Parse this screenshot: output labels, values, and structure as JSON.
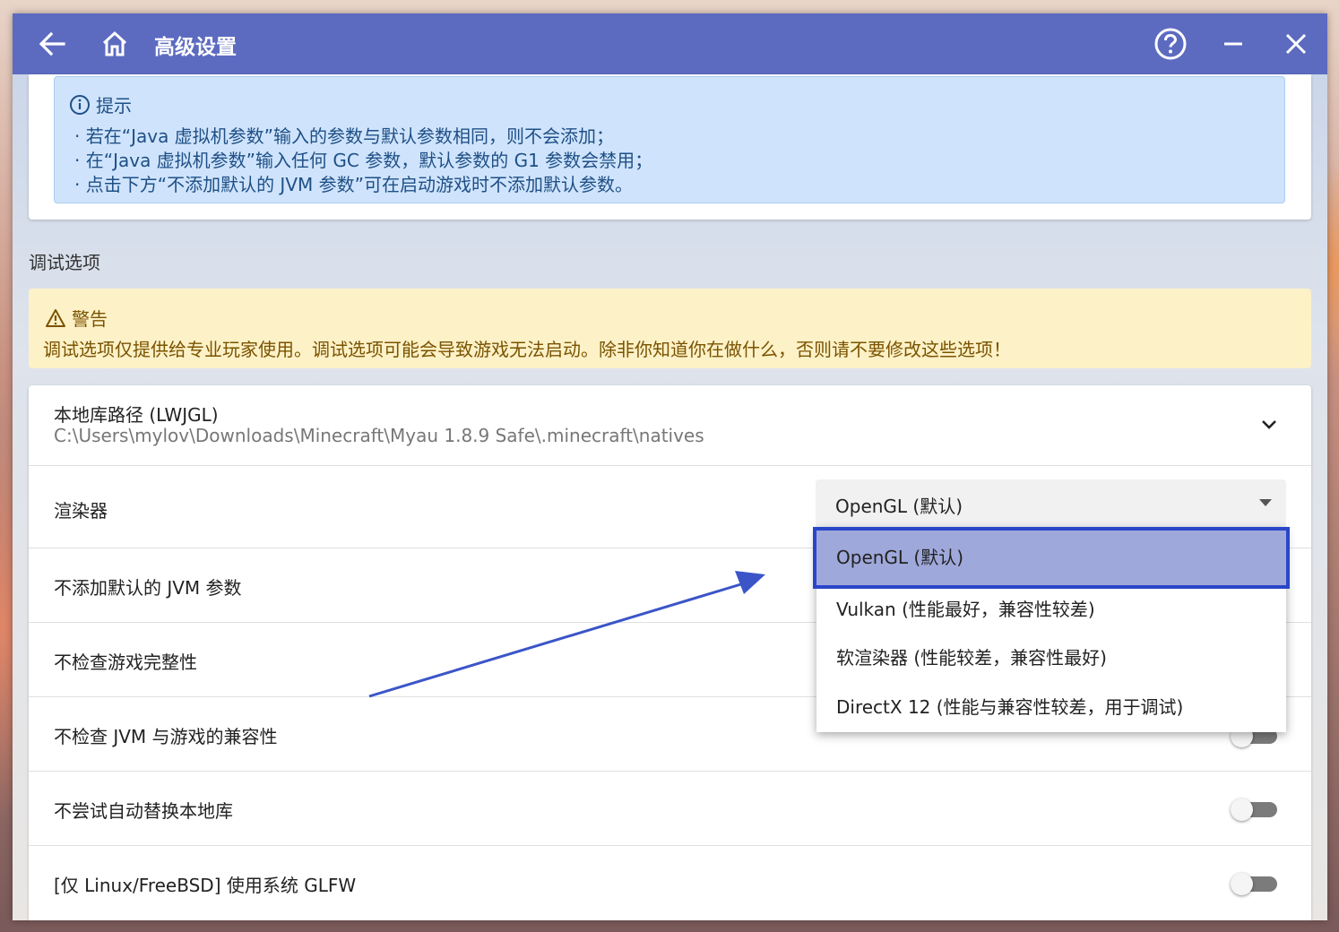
{
  "titlebar": {
    "title": "高级设置",
    "back_icon": "arrow-left-icon",
    "home_icon": "home-icon",
    "help_icon": "help-circle-icon",
    "minimize_icon": "minimize-icon",
    "close_icon": "close-icon"
  },
  "tip": {
    "title": "提示",
    "lines": [
      "· 若在“Java 虚拟机参数”输入的参数与默认参数相同，则不会添加；",
      "· 在“Java 虚拟机参数”输入任何 GC 参数，默认参数的 G1 参数会禁用；",
      "· 点击下方“不添加默认的 JVM 参数”可在启动游戏时不添加默认参数。"
    ]
  },
  "debug": {
    "section_label": "调试选项",
    "warning_title": "警告",
    "warning_text": "调试选项仅提供给专业玩家使用。调试选项可能会导致游戏无法启动。除非你知道你在做什么，否则请不要修改这些选项！"
  },
  "settings": {
    "native_path_label": "本地库路径 (LWJGL)",
    "native_path_value": "C:\\Users\\mylov\\Downloads\\Minecraft\\Myau 1.8.9 Safe\\.minecraft\\natives",
    "renderer_label": "渲染器",
    "renderer_value": "OpenGL (默认)",
    "rows": [
      "不添加默认的 JVM 参数",
      "不检查游戏完整性",
      "不检查 JVM 与游戏的兼容性",
      "不尝试自动替换本地库",
      "[仅 Linux/FreeBSD] 使用系统 GLFW"
    ]
  },
  "dropdown": {
    "options": [
      "OpenGL (默认)",
      "Vulkan (性能最好，兼容性较差)",
      "软渲染器 (性能较差，兼容性最好)",
      "DirectX 12 (性能与兼容性较差，用于调试)"
    ],
    "selected_index": 0
  },
  "colors": {
    "titlebar": "#5c6bc0",
    "selected_option": "#9fa8da",
    "highlight_border": "#2946c9",
    "annotation_arrow": "#3b55c8"
  }
}
